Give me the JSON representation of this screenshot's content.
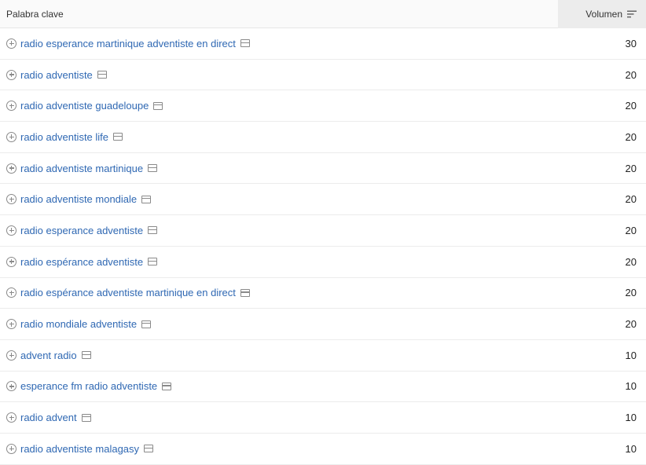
{
  "header": {
    "keyword_label": "Palabra clave",
    "volume_label": "Volumen"
  },
  "rows": [
    {
      "keyword": "radio esperance martinique adventiste en direct",
      "volume": "30"
    },
    {
      "keyword": "radio adventiste",
      "volume": "20"
    },
    {
      "keyword": "radio adventiste guadeloupe",
      "volume": "20"
    },
    {
      "keyword": "radio adventiste life",
      "volume": "20"
    },
    {
      "keyword": "radio adventiste martinique",
      "volume": "20"
    },
    {
      "keyword": "radio adventiste mondiale",
      "volume": "20"
    },
    {
      "keyword": "radio esperance adventiste",
      "volume": "20"
    },
    {
      "keyword": "radio espérance adventiste",
      "volume": "20"
    },
    {
      "keyword": "radio espérance adventiste martinique en direct",
      "volume": "20"
    },
    {
      "keyword": "radio mondiale adventiste",
      "volume": "20"
    },
    {
      "keyword": "advent radio",
      "volume": "10"
    },
    {
      "keyword": "esperance fm radio adventiste",
      "volume": "10"
    },
    {
      "keyword": "radio advent",
      "volume": "10"
    },
    {
      "keyword": "radio adventiste malagasy",
      "volume": "10"
    }
  ]
}
